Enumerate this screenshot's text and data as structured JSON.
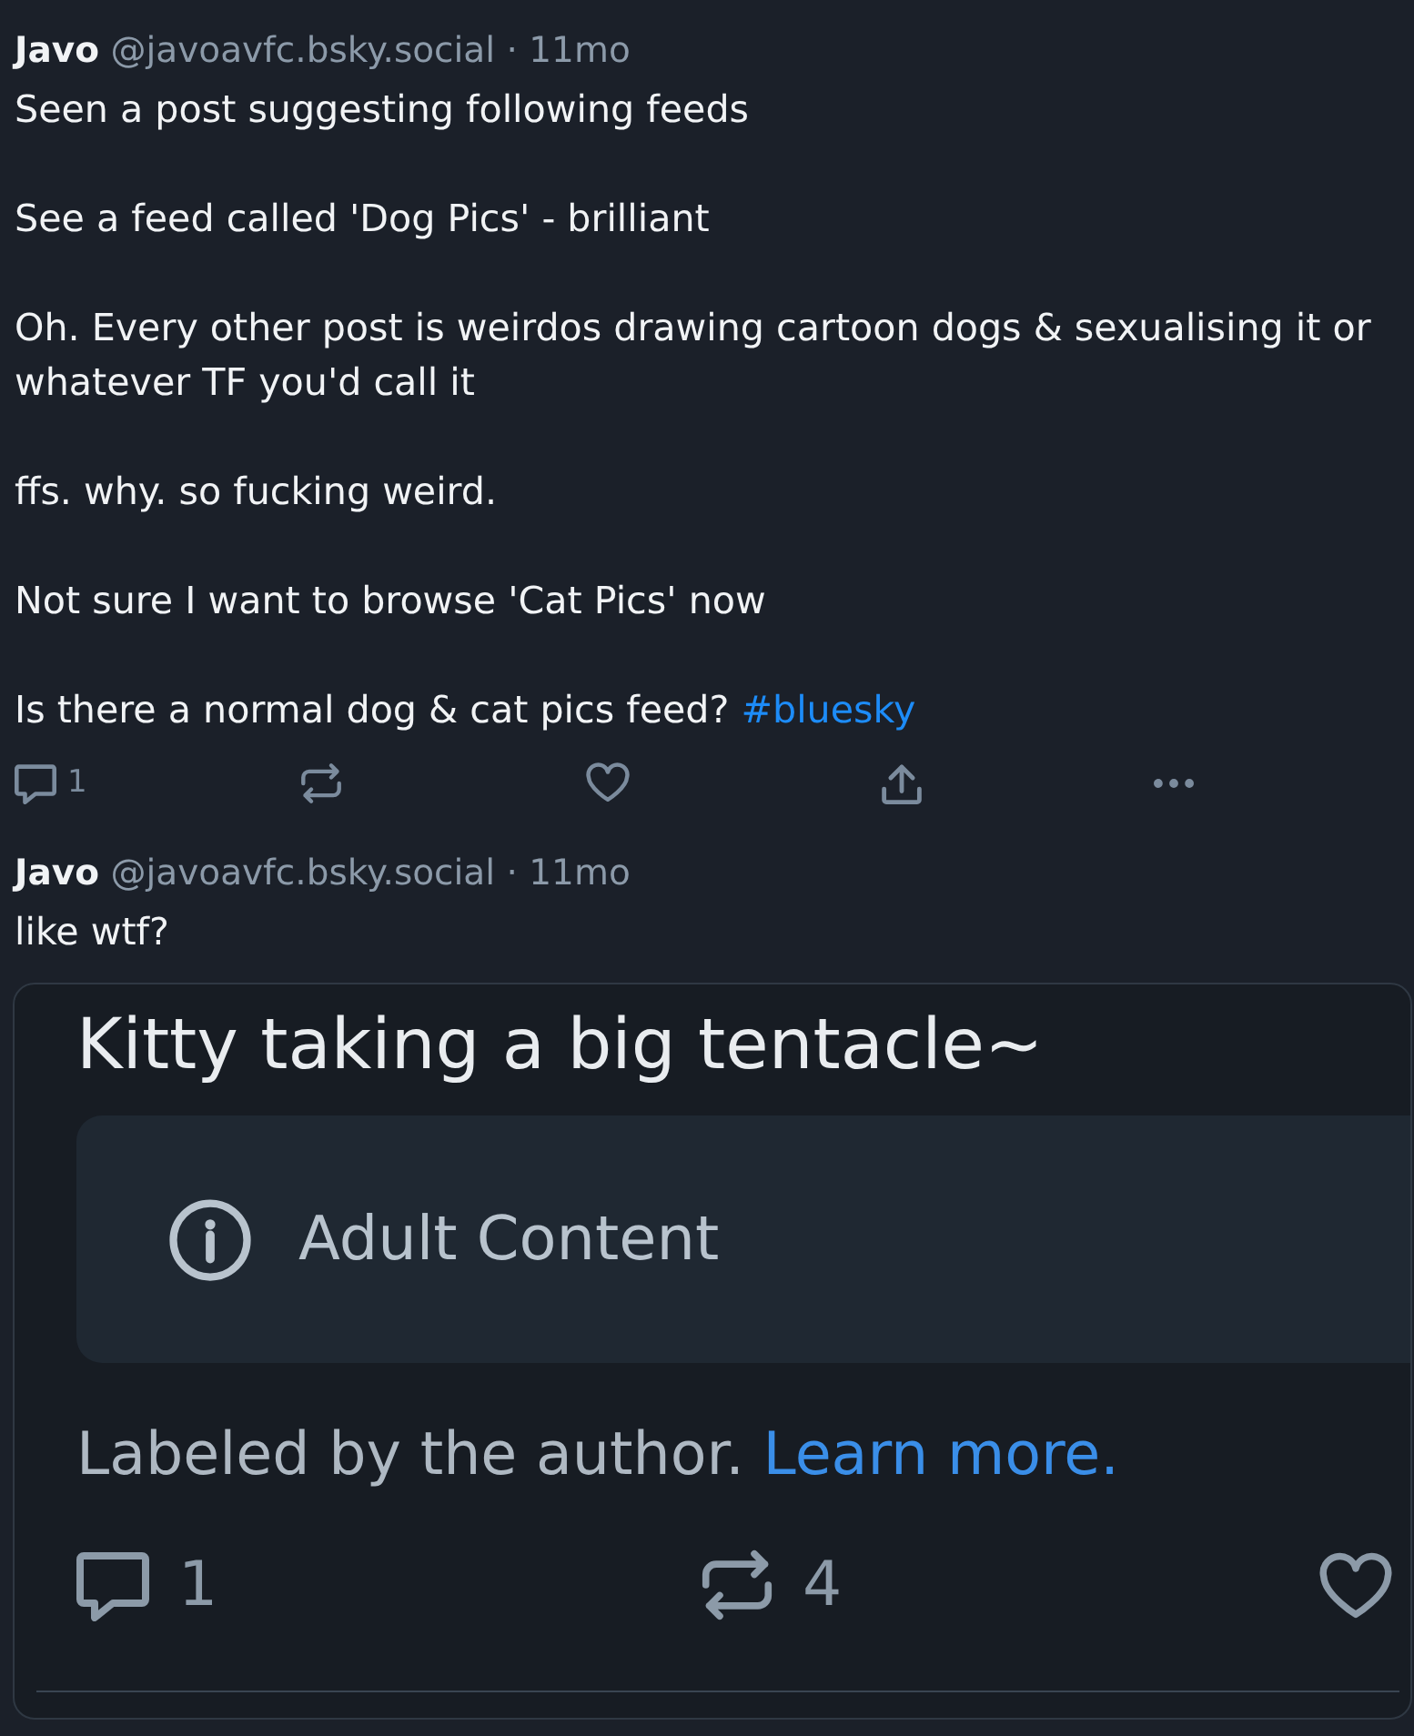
{
  "posts": [
    {
      "author": "Javo",
      "handle": "@javoavfc.bsky.social",
      "time": "· 11mo",
      "paragraphs": [
        {
          "text": "Seen a post suggesting following feeds"
        },
        {
          "text": "See a feed called 'Dog Pics' - brilliant"
        },
        {
          "text": "Oh. Every other post is weirdos drawing cartoon dogs & sexualising it or whatever TF you'd call it"
        },
        {
          "text": "ffs. why. so fucking weird."
        },
        {
          "text": "Not sure I want to browse 'Cat Pics' now"
        },
        {
          "text": "Is there a normal dog & cat pics feed?",
          "hashtag": "#bluesky"
        }
      ],
      "actions": [
        {
          "kind": "reply",
          "count": "1"
        },
        {
          "kind": "repost"
        },
        {
          "kind": "like"
        },
        {
          "kind": "share"
        },
        {
          "kind": "more"
        }
      ]
    },
    {
      "author": "Javo",
      "handle": "@javoavfc.bsky.social",
      "time": "· 11mo",
      "paragraphs": [
        {
          "text": "like wtf?"
        }
      ],
      "embedded_screenshot": {
        "title": "Kitty taking a big tentacle~",
        "content_warning": "Adult Content",
        "label_note": "Labeled by the author.",
        "learn_more": "Learn more.",
        "actions": [
          {
            "kind": "reply",
            "count": "1"
          },
          {
            "kind": "repost",
            "count": "4"
          },
          {
            "kind": "like"
          }
        ]
      }
    }
  ]
}
